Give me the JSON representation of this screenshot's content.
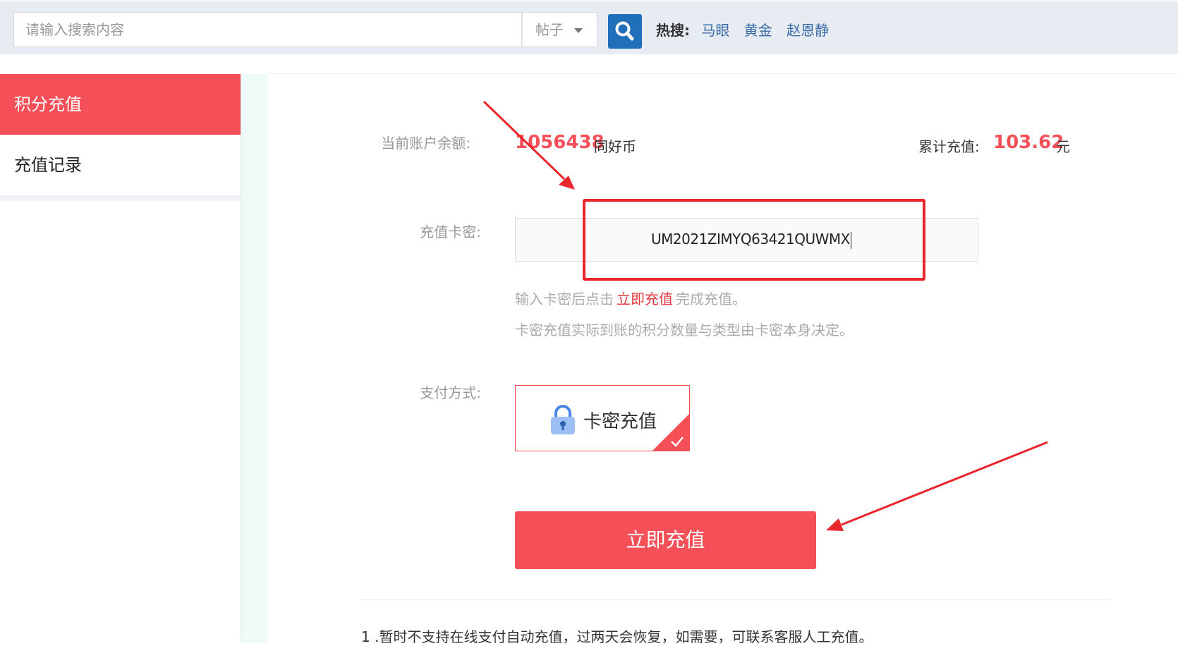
{
  "search": {
    "placeholder": "请输入搜索内容",
    "type_value": "帖子",
    "hot_label": "热搜:",
    "hot_items": [
      "马眼",
      "黄金",
      "赵恩静"
    ]
  },
  "sidebar": {
    "items": [
      {
        "label": "积分充值",
        "active": true
      },
      {
        "label": "充值记录",
        "active": false
      }
    ]
  },
  "main": {
    "balance_label": "当前账户余额:",
    "balance_value": "1056438",
    "balance_unit": "同好币",
    "total_label": "累计充值:",
    "total_value": "103.62",
    "total_unit": "元",
    "card_label": "充值卡密:",
    "card_value": "UM2021ZIMYQ63421QUWMX",
    "hint_prefix": "输入卡密后点击",
    "hint_emphasis": "立即充值",
    "hint_suffix": "完成充值。",
    "hint2": "卡密充值实际到账的积分数量与类型由卡密本身决定。",
    "pay_label": "支付方式:",
    "pay_option": "卡密充值",
    "submit_label": "立即充值",
    "note1": "1 .暂时不支持在线支付自动充值，过两天会恢复，如需要，可联系客服人工充值。"
  },
  "colors": {
    "accent": "#f55057",
    "annotation": "#e8262b",
    "search_button": "#1f6fba",
    "hot_link": "#3a6aa8"
  }
}
